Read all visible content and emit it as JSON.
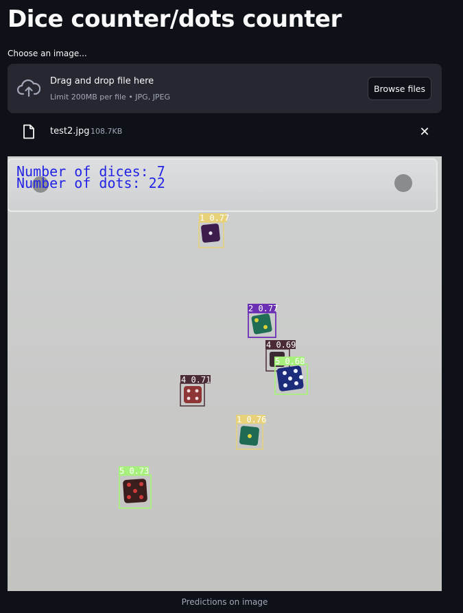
{
  "header": {
    "title": "Dice counter/dots counter"
  },
  "uploader": {
    "label": "Choose an image...",
    "drop_text": "Drag and drop file here",
    "limit_text": "Limit 200MB per file • JPG, JPEG",
    "browse_label": "Browse files",
    "icon": "cloud-upload-icon"
  },
  "file": {
    "name": "test2.jpg",
    "size": "108.7KB",
    "icon": "file-icon",
    "remove_label": "✕"
  },
  "prediction": {
    "overlay_line1": "Number of dices: 7",
    "overlay_line2": "Number of dots: 22",
    "overlay_color": "#2323e6",
    "caption": "Predictions on image",
    "detections": [
      {
        "label": "1 0.77",
        "color": "#e7d27a"
      },
      {
        "label": "2 0.77",
        "color": "#6a2fb3"
      },
      {
        "label": "4 0.69",
        "color": "#4a2b35"
      },
      {
        "label": "5 0.68",
        "color": "#a8f07e"
      },
      {
        "label": "4 0.71",
        "color": "#4a2b35"
      },
      {
        "label": "1 0.76",
        "color": "#e7d27a"
      },
      {
        "label": "5 0.73",
        "color": "#a8f07e"
      }
    ]
  }
}
